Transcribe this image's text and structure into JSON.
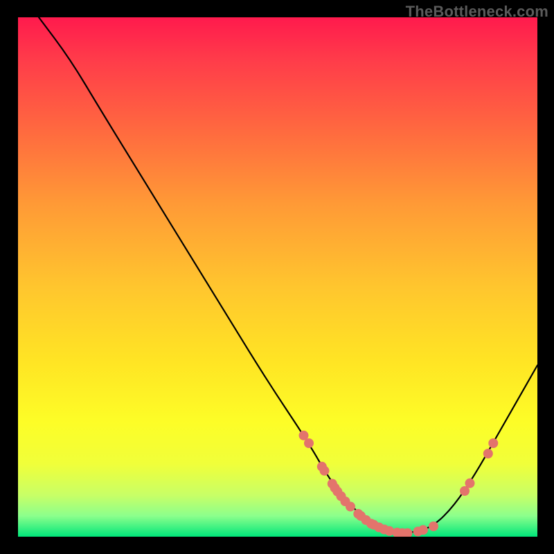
{
  "watermark": "TheBottleneck.com",
  "chart_data": {
    "type": "line",
    "title": "",
    "xlabel": "",
    "ylabel": "",
    "xlim": [
      0,
      100
    ],
    "ylim": [
      0,
      100
    ],
    "curve": {
      "name": "bottleneck-curve",
      "points": [
        {
          "x": 4.0,
          "y": 100.0
        },
        {
          "x": 10.0,
          "y": 92.0
        },
        {
          "x": 16.0,
          "y": 82.0
        },
        {
          "x": 24.0,
          "y": 69.0
        },
        {
          "x": 32.0,
          "y": 56.0
        },
        {
          "x": 40.0,
          "y": 43.0
        },
        {
          "x": 48.0,
          "y": 30.0
        },
        {
          "x": 56.0,
          "y": 18.0
        },
        {
          "x": 60.0,
          "y": 11.0
        },
        {
          "x": 64.0,
          "y": 6.0
        },
        {
          "x": 68.0,
          "y": 2.5
        },
        {
          "x": 72.0,
          "y": 1.0
        },
        {
          "x": 76.0,
          "y": 0.7
        },
        {
          "x": 80.0,
          "y": 2.0
        },
        {
          "x": 84.0,
          "y": 6.0
        },
        {
          "x": 88.0,
          "y": 12.0
        },
        {
          "x": 92.0,
          "y": 19.0
        },
        {
          "x": 96.0,
          "y": 26.0
        },
        {
          "x": 100.0,
          "y": 33.0
        }
      ]
    },
    "markers": [
      {
        "x": 55.0,
        "y": 19.5
      },
      {
        "x": 56.0,
        "y": 18.0
      },
      {
        "x": 58.5,
        "y": 13.5
      },
      {
        "x": 59.0,
        "y": 12.7
      },
      {
        "x": 60.5,
        "y": 10.2
      },
      {
        "x": 61.0,
        "y": 9.4
      },
      {
        "x": 61.5,
        "y": 8.7
      },
      {
        "x": 62.2,
        "y": 7.8
      },
      {
        "x": 63.0,
        "y": 6.8
      },
      {
        "x": 64.0,
        "y": 5.8
      },
      {
        "x": 65.5,
        "y": 4.4
      },
      {
        "x": 66.0,
        "y": 4.0
      },
      {
        "x": 67.0,
        "y": 3.2
      },
      {
        "x": 68.0,
        "y": 2.5
      },
      {
        "x": 68.5,
        "y": 2.3
      },
      {
        "x": 69.5,
        "y": 1.8
      },
      {
        "x": 70.5,
        "y": 1.4
      },
      {
        "x": 71.5,
        "y": 1.1
      },
      {
        "x": 73.0,
        "y": 0.8
      },
      {
        "x": 74.0,
        "y": 0.7
      },
      {
        "x": 75.0,
        "y": 0.7
      },
      {
        "x": 77.0,
        "y": 1.0
      },
      {
        "x": 78.0,
        "y": 1.3
      },
      {
        "x": 80.0,
        "y": 2.0
      },
      {
        "x": 86.0,
        "y": 8.8
      },
      {
        "x": 87.0,
        "y": 10.3
      },
      {
        "x": 90.5,
        "y": 16.0
      },
      {
        "x": 91.5,
        "y": 18.0
      }
    ],
    "marker_color": "#e3746c",
    "marker_radius_px": 7
  }
}
